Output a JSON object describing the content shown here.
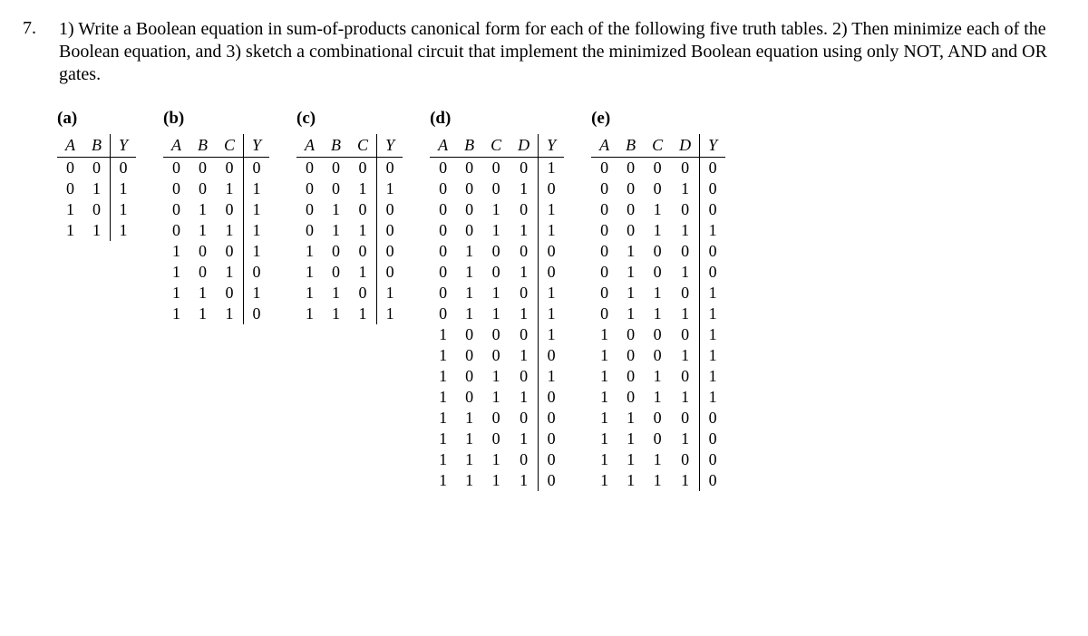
{
  "question": {
    "number": "7.",
    "text": "1) Write a Boolean equation in sum-of-products canonical form for each of the following five truth tables. 2) Then minimize each of the Boolean equation, and 3) sketch a combinational circuit that implement the minimized Boolean equation using only NOT, AND and OR gates."
  },
  "tables": [
    {
      "label": "(a)",
      "headers": [
        "A",
        "B",
        "Y"
      ],
      "rows": [
        [
          0,
          0,
          0
        ],
        [
          0,
          1,
          1
        ],
        [
          1,
          0,
          1
        ],
        [
          1,
          1,
          1
        ]
      ]
    },
    {
      "label": "(b)",
      "headers": [
        "A",
        "B",
        "C",
        "Y"
      ],
      "rows": [
        [
          0,
          0,
          0,
          0
        ],
        [
          0,
          0,
          1,
          1
        ],
        [
          0,
          1,
          0,
          1
        ],
        [
          0,
          1,
          1,
          1
        ],
        [
          1,
          0,
          0,
          1
        ],
        [
          1,
          0,
          1,
          0
        ],
        [
          1,
          1,
          0,
          1
        ],
        [
          1,
          1,
          1,
          0
        ]
      ]
    },
    {
      "label": "(c)",
      "headers": [
        "A",
        "B",
        "C",
        "Y"
      ],
      "rows": [
        [
          0,
          0,
          0,
          0
        ],
        [
          0,
          0,
          1,
          1
        ],
        [
          0,
          1,
          0,
          0
        ],
        [
          0,
          1,
          1,
          0
        ],
        [
          1,
          0,
          0,
          0
        ],
        [
          1,
          0,
          1,
          0
        ],
        [
          1,
          1,
          0,
          1
        ],
        [
          1,
          1,
          1,
          1
        ]
      ]
    },
    {
      "label": "(d)",
      "headers": [
        "A",
        "B",
        "C",
        "D",
        "Y"
      ],
      "rows": [
        [
          0,
          0,
          0,
          0,
          1
        ],
        [
          0,
          0,
          0,
          1,
          0
        ],
        [
          0,
          0,
          1,
          0,
          1
        ],
        [
          0,
          0,
          1,
          1,
          1
        ],
        [
          0,
          1,
          0,
          0,
          0
        ],
        [
          0,
          1,
          0,
          1,
          0
        ],
        [
          0,
          1,
          1,
          0,
          1
        ],
        [
          0,
          1,
          1,
          1,
          1
        ],
        [
          1,
          0,
          0,
          0,
          1
        ],
        [
          1,
          0,
          0,
          1,
          0
        ],
        [
          1,
          0,
          1,
          0,
          1
        ],
        [
          1,
          0,
          1,
          1,
          0
        ],
        [
          1,
          1,
          0,
          0,
          0
        ],
        [
          1,
          1,
          0,
          1,
          0
        ],
        [
          1,
          1,
          1,
          0,
          0
        ],
        [
          1,
          1,
          1,
          1,
          0
        ]
      ]
    },
    {
      "label": "(e)",
      "headers": [
        "A",
        "B",
        "C",
        "D",
        "Y"
      ],
      "rows": [
        [
          0,
          0,
          0,
          0,
          0
        ],
        [
          0,
          0,
          0,
          1,
          0
        ],
        [
          0,
          0,
          1,
          0,
          0
        ],
        [
          0,
          0,
          1,
          1,
          1
        ],
        [
          0,
          1,
          0,
          0,
          0
        ],
        [
          0,
          1,
          0,
          1,
          0
        ],
        [
          0,
          1,
          1,
          0,
          1
        ],
        [
          0,
          1,
          1,
          1,
          1
        ],
        [
          1,
          0,
          0,
          0,
          1
        ],
        [
          1,
          0,
          0,
          1,
          1
        ],
        [
          1,
          0,
          1,
          0,
          1
        ],
        [
          1,
          0,
          1,
          1,
          1
        ],
        [
          1,
          1,
          0,
          0,
          0
        ],
        [
          1,
          1,
          0,
          1,
          0
        ],
        [
          1,
          1,
          1,
          0,
          0
        ],
        [
          1,
          1,
          1,
          1,
          0
        ]
      ]
    }
  ]
}
